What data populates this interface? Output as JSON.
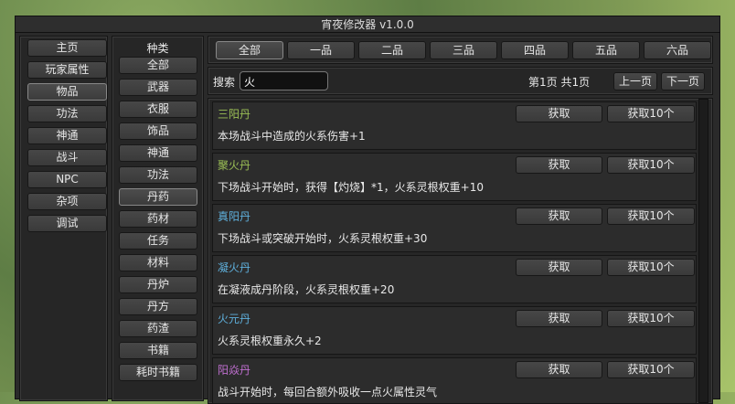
{
  "title": "宵夜修改器 v1.0.0",
  "nav": [
    "主页",
    "玩家属性",
    "物品",
    "功法",
    "神通",
    "战斗",
    "NPC",
    "杂项",
    "调试"
  ],
  "nav_selected": 2,
  "category_label": "种类",
  "categories": [
    "全部",
    "武器",
    "衣服",
    "饰品",
    "神通",
    "功法",
    "丹药",
    "药材",
    "任务",
    "材料",
    "丹炉",
    "丹方",
    "药渣",
    "书籍",
    "耗时书籍"
  ],
  "category_selected": 6,
  "grades": [
    "全部",
    "一品",
    "二品",
    "三品",
    "四品",
    "五品",
    "六品"
  ],
  "grade_selected": 0,
  "search": {
    "label": "搜索",
    "value": "火"
  },
  "pager": {
    "info": "第1页 共1页",
    "prev": "上一页",
    "next": "下一页"
  },
  "actions": {
    "get": "获取",
    "get10": "获取10个"
  },
  "items": [
    {
      "name": "三阳丹",
      "desc": "本场战斗中造成的火系伤害+1",
      "color": "#9bbf55"
    },
    {
      "name": "聚火丹",
      "desc": "下场战斗开始时，获得【灼烧】*1，火系灵根权重+10",
      "color": "#9bbf55"
    },
    {
      "name": "真阳丹",
      "desc": "下场战斗或突破开始时，火系灵根权重+30",
      "color": "#5fb0dc"
    },
    {
      "name": "凝火丹",
      "desc": "在凝液成丹阶段，火系灵根权重+20",
      "color": "#5fb0dc"
    },
    {
      "name": "火元丹",
      "desc": "火系灵根权重永久+2",
      "color": "#5fb0dc"
    },
    {
      "name": "阳焱丹",
      "desc": "战斗开始时，每回合额外吸收一点火属性灵气",
      "color": "#c06fd0"
    }
  ]
}
